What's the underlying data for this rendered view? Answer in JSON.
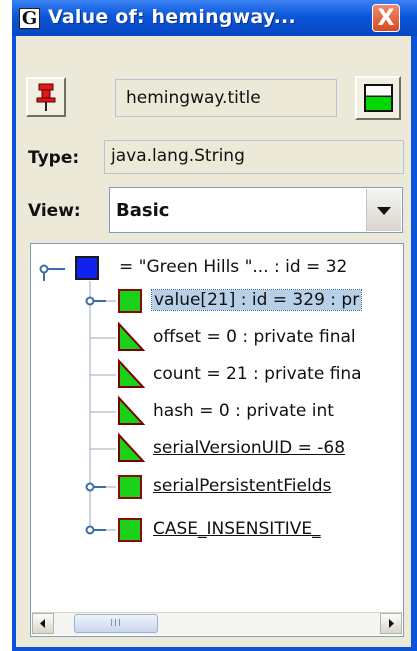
{
  "window": {
    "title": "Value of: hemingway...",
    "logo_letter": "G",
    "close_symbol": "X"
  },
  "toolbar": {
    "pin_icon": "pin-icon",
    "expression": "hemingway.title",
    "color_icon": "green-swatch-icon"
  },
  "type_row": {
    "label": "Type:",
    "value": "java.lang.String"
  },
  "view_row": {
    "label": "View:",
    "selected": "Basic"
  },
  "tree": {
    "root": {
      "text": "= \"Green Hills \"... : id = 32",
      "icon": "blue-square-icon"
    },
    "children": [
      {
        "text": "value[21] : id = 329 : pr",
        "icon": "green-box-icon",
        "expandable": true,
        "underlined": false,
        "selected": true
      },
      {
        "text": "offset = 0 : private final",
        "icon": "triangle-icon",
        "expandable": false,
        "underlined": false,
        "selected": false
      },
      {
        "text": "count = 21 : private fina",
        "icon": "triangle-icon",
        "expandable": false,
        "underlined": false,
        "selected": false
      },
      {
        "text": "hash = 0 : private int",
        "icon": "triangle-icon",
        "expandable": false,
        "underlined": false,
        "selected": false
      },
      {
        "text": "serialVersionUID = -68",
        "icon": "triangle-icon",
        "expandable": false,
        "underlined": true,
        "selected": false
      },
      {
        "text": "serialPersistentFields",
        "icon": "green-box-icon",
        "expandable": true,
        "underlined": true,
        "selected": false
      },
      {
        "text": "CASE_INSENSITIVE_",
        "icon": "green-box-icon",
        "expandable": true,
        "underlined": true,
        "selected": false
      }
    ]
  },
  "scrollbar": {
    "grip": "III"
  },
  "colors": {
    "title_blue": "#0a56d8",
    "panel": "#ece9d8",
    "node_green": "#19d119",
    "node_blue": "#1222ee",
    "border_red": "#8a0a0a"
  }
}
